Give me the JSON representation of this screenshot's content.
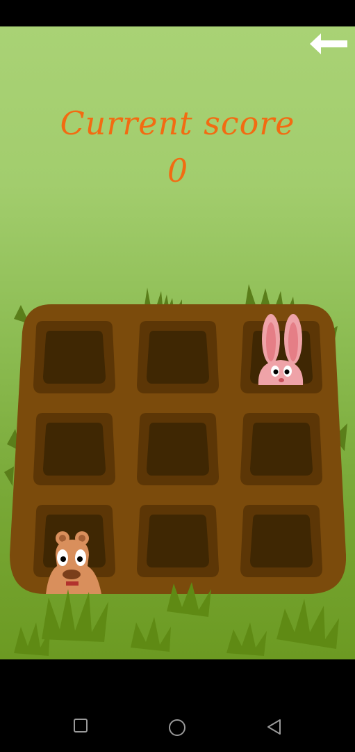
{
  "game": {
    "score_label": "Current score",
    "score_value": "0",
    "accent_color": "#f26b12"
  },
  "icons": {
    "back": "back-arrow-icon",
    "nav_recents": "square-icon",
    "nav_home": "circle-icon",
    "nav_back": "triangle-back-icon"
  },
  "board": {
    "rows": 3,
    "cols": 3,
    "holes": [
      {
        "row": 1,
        "col": 1,
        "occupant": "empty"
      },
      {
        "row": 1,
        "col": 2,
        "occupant": "empty"
      },
      {
        "row": 1,
        "col": 3,
        "occupant": "bunny"
      },
      {
        "row": 2,
        "col": 1,
        "occupant": "empty"
      },
      {
        "row": 2,
        "col": 2,
        "occupant": "empty"
      },
      {
        "row": 2,
        "col": 3,
        "occupant": "empty"
      },
      {
        "row": 3,
        "col": 1,
        "occupant": "mole"
      },
      {
        "row": 3,
        "col": 2,
        "occupant": "empty"
      },
      {
        "row": 3,
        "col": 3,
        "occupant": "empty"
      }
    ],
    "colors": {
      "board": "#7b4b0c",
      "hole_rim": "#5c3606",
      "hole_inside": "#3f2703"
    }
  }
}
